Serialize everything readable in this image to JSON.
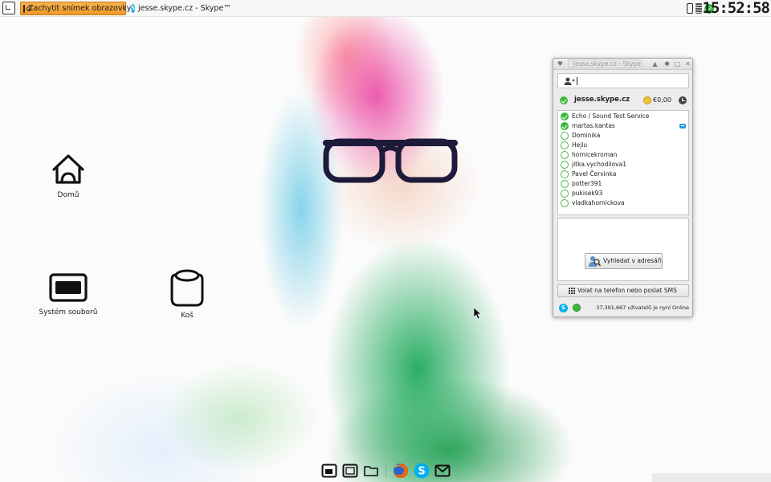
{
  "panel": {
    "tasks": [
      {
        "label": "Zachytit snímek obrazovky",
        "icon": "camera-icon",
        "active": true
      },
      {
        "label": "jesse.skype.cz - Skype™",
        "icon": "skype-icon",
        "active": false
      }
    ],
    "tray": {
      "arrow": "›",
      "icons": [
        "battery-icon",
        "network-icon",
        "skype-status-icon"
      ]
    },
    "clock": "15:52:58"
  },
  "desktop": {
    "icons": [
      {
        "label": "Domů",
        "icon": "home-icon"
      },
      {
        "label": "Systém souborů",
        "icon": "drive-icon"
      },
      {
        "label": "Koš",
        "icon": "trash-icon"
      }
    ]
  },
  "skype": {
    "title": "jesse.skype.cz - Skype™",
    "search_value": "",
    "account": {
      "name": "jesse.skype.cz",
      "credit": "€0,00",
      "status": "online"
    },
    "contacts": [
      {
        "name": "Echo / Sound Test Service",
        "status": "online",
        "chat": false
      },
      {
        "name": "martas.kantas",
        "status": "online",
        "chat": true
      },
      {
        "name": "Dominika",
        "status": "offline",
        "chat": false
      },
      {
        "name": "Hejlu",
        "status": "offline",
        "chat": false
      },
      {
        "name": "hornicekroman",
        "status": "offline",
        "chat": false
      },
      {
        "name": "jitka.vychodilova1",
        "status": "offline",
        "chat": false
      },
      {
        "name": "Pavel Červinka",
        "status": "offline",
        "chat": false
      },
      {
        "name": "potter391",
        "status": "offline",
        "chat": false
      },
      {
        "name": "pukisek93",
        "status": "offline",
        "chat": false
      },
      {
        "name": "vladkahornickova",
        "status": "offline",
        "chat": false
      }
    ],
    "directory_button": "Vyhledat v adresáři",
    "call_button": "Volat na telefon nebo poslat SMS",
    "online_count": "37,391,667 uživatelů je nyní Online"
  },
  "dock": {
    "items": [
      "window-icon",
      "desktop-icon",
      "folder-icon",
      "firefox-icon",
      "skype-icon",
      "mail-icon"
    ]
  },
  "colors": {
    "accent": "#f09a2a",
    "skype_blue": "#00aff0",
    "online_green": "#3db83d"
  }
}
